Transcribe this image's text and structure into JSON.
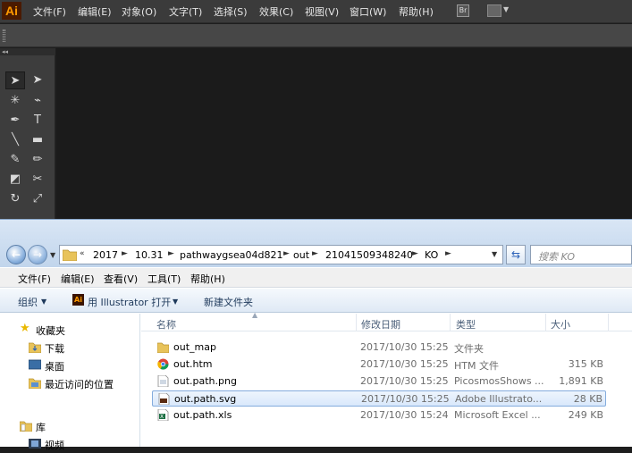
{
  "illustrator": {
    "logo": "Ai",
    "menus": [
      "文件(F)",
      "编辑(E)",
      "对象(O)",
      "文字(T)",
      "选择(S)",
      "效果(C)",
      "视图(V)",
      "窗口(W)",
      "帮助(H)"
    ],
    "br_label": "Br",
    "dock_collapse": "◂◂",
    "tools": [
      {
        "icon": "selection-tool-icon",
        "glyph": "➤"
      },
      {
        "icon": "direct-selection-tool-icon",
        "glyph": "➤"
      },
      {
        "icon": "magic-wand-tool-icon",
        "glyph": "✳"
      },
      {
        "icon": "lasso-tool-icon",
        "glyph": "⌁"
      },
      {
        "icon": "pen-tool-icon",
        "glyph": "✒"
      },
      {
        "icon": "type-tool-icon",
        "glyph": "T"
      },
      {
        "icon": "line-tool-icon",
        "glyph": "╲"
      },
      {
        "icon": "rectangle-tool-icon",
        "glyph": "▬"
      },
      {
        "icon": "paintbrush-tool-icon",
        "glyph": "✎"
      },
      {
        "icon": "pencil-tool-icon",
        "glyph": "✏"
      },
      {
        "icon": "eraser-tool-icon",
        "glyph": "◩"
      },
      {
        "icon": "scissors-tool-icon",
        "glyph": "✂"
      },
      {
        "icon": "rotate-tool-icon",
        "glyph": "↻"
      },
      {
        "icon": "scale-tool-icon",
        "glyph": "⤢"
      }
    ]
  },
  "explorer": {
    "breadcrumbs": [
      "2017",
      "10.31",
      "pathwaygsea04d821",
      "out",
      "21041509348240",
      "KO"
    ],
    "overflow": "«",
    "search_placeholder": "搜索 KO",
    "menus": [
      "文件(F)",
      "编辑(E)",
      "查看(V)",
      "工具(T)",
      "帮助(H)"
    ],
    "commands": {
      "organize": "组织",
      "open_with": "用 Illustrator 打开",
      "new_folder": "新建文件夹"
    },
    "nav": {
      "favorites": "收藏夹",
      "downloads": "下载",
      "desktop": "桌面",
      "recent": "最近访问的位置",
      "libraries": "库",
      "videos": "视频"
    },
    "columns": {
      "name": "名称",
      "date": "修改日期",
      "type": "类型",
      "size": "大小"
    },
    "files": [
      {
        "name": "out_map",
        "date": "2017/10/30 15:25",
        "type": "文件夹",
        "size": "",
        "icon": "folder-icon"
      },
      {
        "name": "out.htm",
        "date": "2017/10/30 15:25",
        "type": "HTM 文件",
        "size": "315 KB",
        "icon": "chrome-icon"
      },
      {
        "name": "out.path.png",
        "date": "2017/10/30 15:25",
        "type": "PicosmosShows ...",
        "size": "1,891 KB",
        "icon": "image-file-icon"
      },
      {
        "name": "out.path.svg",
        "date": "2017/10/30 15:25",
        "type": "Adobe Illustrato...",
        "size": "28 KB",
        "icon": "svg-file-icon",
        "selected": true
      },
      {
        "name": "out.path.xls",
        "date": "2017/10/30 15:24",
        "type": "Microsoft Excel ...",
        "size": "249 KB",
        "icon": "excel-file-icon"
      }
    ]
  }
}
